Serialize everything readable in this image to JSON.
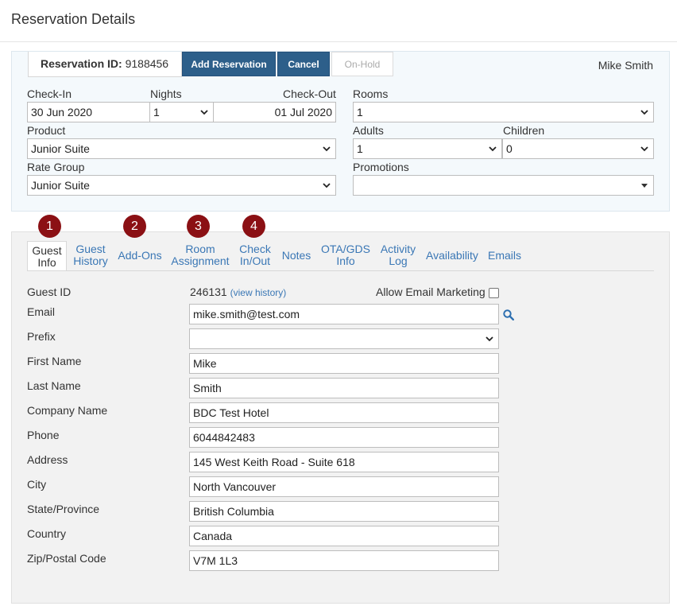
{
  "page": {
    "title": "Reservation Details"
  },
  "header": {
    "reservation_id_label": "Reservation ID:",
    "reservation_id": "9188456",
    "add_reservation_label": "Add Reservation",
    "cancel_label": "Cancel",
    "on_hold_label": "On-Hold",
    "user_name": "Mike Smith"
  },
  "booking": {
    "check_in_label": "Check-In",
    "check_in": "30 Jun 2020",
    "nights_label": "Nights",
    "nights": "1",
    "check_out_label": "Check-Out",
    "check_out": "01 Jul 2020",
    "rooms_label": "Rooms",
    "rooms": "1",
    "product_label": "Product",
    "product": "Junior Suite",
    "adults_label": "Adults",
    "adults": "1",
    "children_label": "Children",
    "children": "0",
    "rate_group_label": "Rate Group",
    "rate_group": "Junior Suite",
    "promotions_label": "Promotions",
    "promotions": ""
  },
  "badges": [
    "1",
    "2",
    "3",
    "4"
  ],
  "tabs": [
    {
      "line1": "Guest",
      "line2": "Info"
    },
    {
      "line1": "Guest",
      "line2": "History"
    },
    {
      "line1": "Add-Ons",
      "line2": ""
    },
    {
      "line1": "Room",
      "line2": "Assignment"
    },
    {
      "line1": "Check",
      "line2": "In/Out"
    },
    {
      "line1": "Notes",
      "line2": ""
    },
    {
      "line1": "OTA/GDS",
      "line2": "Info"
    },
    {
      "line1": "Activity",
      "line2": "Log"
    },
    {
      "line1": "Availability",
      "line2": ""
    },
    {
      "line1": "Emails",
      "line2": ""
    }
  ],
  "guest": {
    "guest_id_label": "Guest ID",
    "guest_id": "246131",
    "view_history_label": "(view history)",
    "allow_email_marketing_label": "Allow Email Marketing",
    "email_label": "Email",
    "email": "mike.smith@test.com",
    "prefix_label": "Prefix",
    "prefix": "",
    "first_name_label": "First Name",
    "first_name": "Mike",
    "last_name_label": "Last Name",
    "last_name": "Smith",
    "company_label": "Company Name",
    "company": "BDC Test Hotel",
    "phone_label": "Phone",
    "phone": "6044842483",
    "address_label": "Address",
    "address": "145 West Keith Road - Suite 618",
    "city_label": "City",
    "city": "North Vancouver",
    "state_label": "State/Province",
    "state": "British Columbia",
    "country_label": "Country",
    "country": "Canada",
    "zip_label": "Zip/Postal Code",
    "zip": "V7M 1L3"
  },
  "colors": {
    "primary_button": "#2d5f8a",
    "badge": "#8b1014",
    "link": "#3a77b5"
  },
  "icons": {
    "search": "search-icon",
    "dropdown": "chevron-down-icon"
  }
}
